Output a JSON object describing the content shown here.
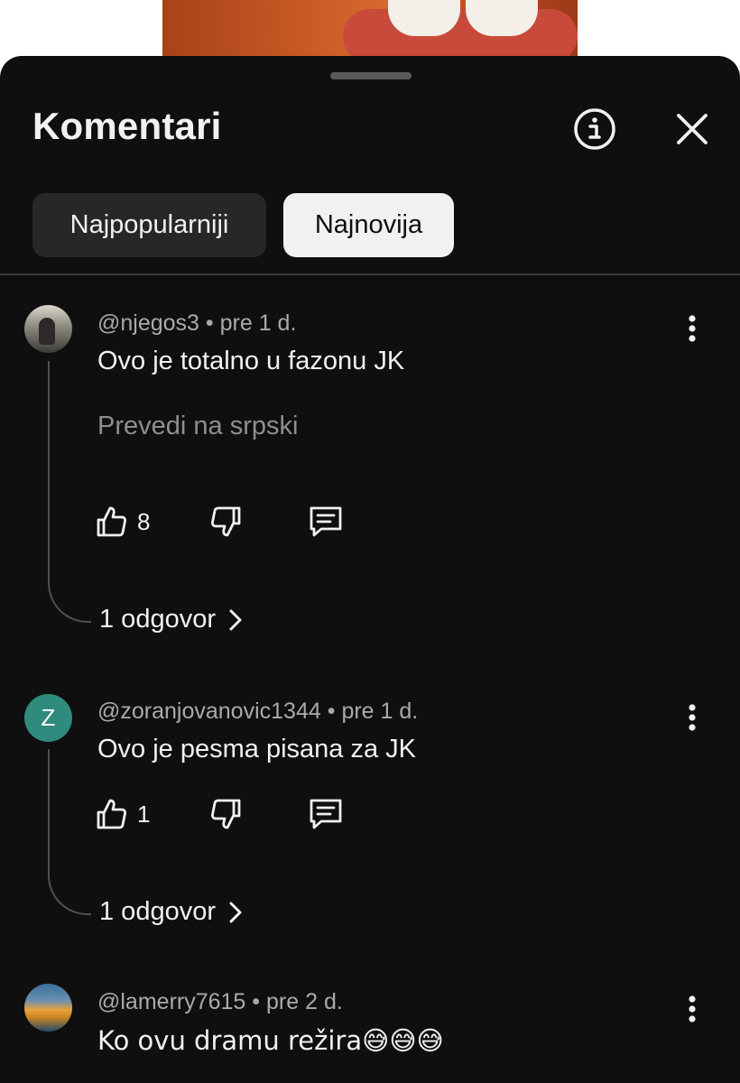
{
  "sheet": {
    "title": "Komentari",
    "info_icon": "info-circle-icon",
    "close_icon": "close-icon"
  },
  "filters": [
    {
      "label": "Najpopularniji",
      "selected": false
    },
    {
      "label": "Najnovija",
      "selected": true
    }
  ],
  "comments": [
    {
      "author": "@njegos3",
      "time": "pre 1 d.",
      "text": "Ovo je totalno u fazonu JK",
      "translate_label": "Prevedi na srpski",
      "likes": "8",
      "replies": "1 odgovor"
    },
    {
      "author": "@zoranjovanovic1344",
      "avatar_letter": "Z",
      "time": "pre 1 d.",
      "text": "Ovo je pesma pisana za JK",
      "likes": "1",
      "replies": "1 odgovor"
    },
    {
      "author": "@lamerry7615",
      "time": "pre 2 d.",
      "text": "Ko ovu dramu režira😅😅😅"
    }
  ],
  "separator": "•",
  "colors": {
    "background": "#0f0f0f",
    "chip_selected": "#f1f1f1",
    "chip_unselected": "#272727",
    "avatar_z": "#2f8b7d"
  }
}
